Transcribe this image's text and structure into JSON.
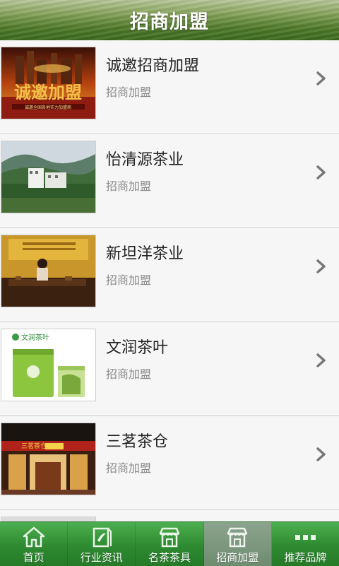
{
  "header": {
    "title": "招商加盟"
  },
  "items": [
    {
      "name": "诚邀招商加盟",
      "sub": "招商加盟"
    },
    {
      "name": "怡清源茶业",
      "sub": "招商加盟"
    },
    {
      "name": "新坦洋茶业",
      "sub": "招商加盟"
    },
    {
      "name": "文润茶叶",
      "sub": "招商加盟"
    },
    {
      "name": "三茗茶仓",
      "sub": "招商加盟"
    }
  ],
  "thumbs": {
    "banner_text": "诚邀加盟",
    "banner_sub": "诚邀全国各地实力加盟商",
    "wenrun_brand": "文润茶叶",
    "sanming_sign": "三茗茶仓"
  },
  "tabs": [
    {
      "label": "首页",
      "icon": "home-icon"
    },
    {
      "label": "行业资讯",
      "icon": "news-icon"
    },
    {
      "label": "名茶茶具",
      "icon": "shop-icon"
    },
    {
      "label": "招商加盟",
      "icon": "shop-icon",
      "active": true
    },
    {
      "label": "推荐品牌",
      "icon": "more-icon"
    }
  ],
  "colors": {
    "tabbar": "#2e8a31",
    "active_tab": "#7a957b",
    "header": "#4f7a2a"
  }
}
